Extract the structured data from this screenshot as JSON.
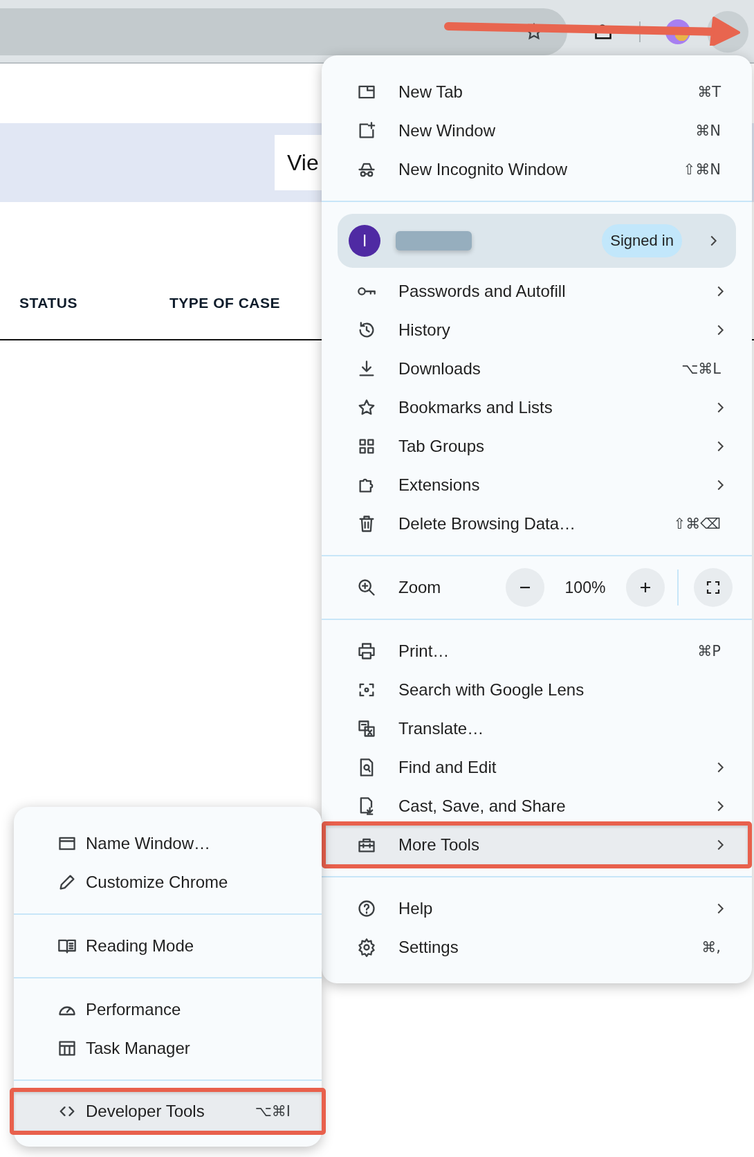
{
  "toolbar": {
    "menu_open": true
  },
  "page": {
    "view_button": "Vie",
    "columns": [
      "STATUS",
      "TYPE OF CASE"
    ]
  },
  "menu": {
    "sections": [
      {
        "items": [
          {
            "kind": "item",
            "label": "New Tab",
            "shortcut": "⌘T",
            "submenu": false,
            "selected": false
          },
          {
            "kind": "item",
            "label": "New Window",
            "shortcut": "⌘N",
            "submenu": false,
            "selected": false
          },
          {
            "kind": "item",
            "label": "New Incognito Window",
            "shortcut": "⇧⌘N",
            "submenu": false,
            "selected": false
          }
        ]
      },
      {
        "items": [
          {
            "kind": "profile",
            "avatar": "I",
            "status": "Signed in",
            "submenu": true
          },
          {
            "kind": "item",
            "label": "Passwords and Autofill",
            "submenu": true,
            "selected": false
          },
          {
            "kind": "item",
            "label": "History",
            "submenu": true,
            "selected": false
          },
          {
            "kind": "item",
            "label": "Downloads",
            "shortcut": "⌥⌘L",
            "submenu": false,
            "selected": false
          },
          {
            "kind": "item",
            "label": "Bookmarks and Lists",
            "submenu": true,
            "selected": false
          },
          {
            "kind": "item",
            "label": "Tab Groups",
            "submenu": true,
            "selected": false
          },
          {
            "kind": "item",
            "label": "Extensions",
            "submenu": true,
            "selected": false
          },
          {
            "kind": "item",
            "label": "Delete Browsing Data…",
            "shortcut": "⇧⌘⌫",
            "submenu": false,
            "selected": false
          }
        ]
      },
      {
        "items": [
          {
            "kind": "zoom",
            "label": "Zoom",
            "value": "100%"
          }
        ]
      },
      {
        "items": [
          {
            "kind": "item",
            "label": "Print…",
            "shortcut": "⌘P",
            "submenu": false,
            "selected": false
          },
          {
            "kind": "item",
            "label": "Search with Google Lens",
            "submenu": false,
            "selected": false
          },
          {
            "kind": "item",
            "label": "Translate…",
            "submenu": false,
            "selected": false
          },
          {
            "kind": "item",
            "label": "Find and Edit",
            "submenu": true,
            "selected": false
          },
          {
            "kind": "item",
            "label": "Cast, Save, and Share",
            "submenu": true,
            "selected": false
          },
          {
            "kind": "item",
            "label": "More Tools",
            "submenu": true,
            "selected": true
          }
        ]
      },
      {
        "items": [
          {
            "kind": "item",
            "label": "Help",
            "submenu": true,
            "selected": false
          },
          {
            "kind": "item",
            "label": "Settings",
            "shortcut": "⌘,",
            "submenu": false,
            "selected": false
          }
        ]
      }
    ]
  },
  "submenu": {
    "sections": [
      {
        "items": [
          {
            "kind": "item",
            "label": "Name Window…",
            "submenu": false,
            "selected": false
          },
          {
            "kind": "item",
            "label": "Customize Chrome",
            "submenu": false,
            "selected": false
          }
        ]
      },
      {
        "items": [
          {
            "kind": "item",
            "label": "Reading Mode",
            "submenu": false,
            "selected": false
          }
        ]
      },
      {
        "items": [
          {
            "kind": "item",
            "label": "Performance",
            "submenu": false,
            "selected": false
          },
          {
            "kind": "item",
            "label": "Task Manager",
            "submenu": false,
            "selected": false
          }
        ]
      },
      {
        "items": [
          {
            "kind": "item",
            "label": "Developer Tools",
            "shortcut": "⌥⌘I",
            "submenu": false,
            "selected": true
          }
        ]
      }
    ]
  }
}
